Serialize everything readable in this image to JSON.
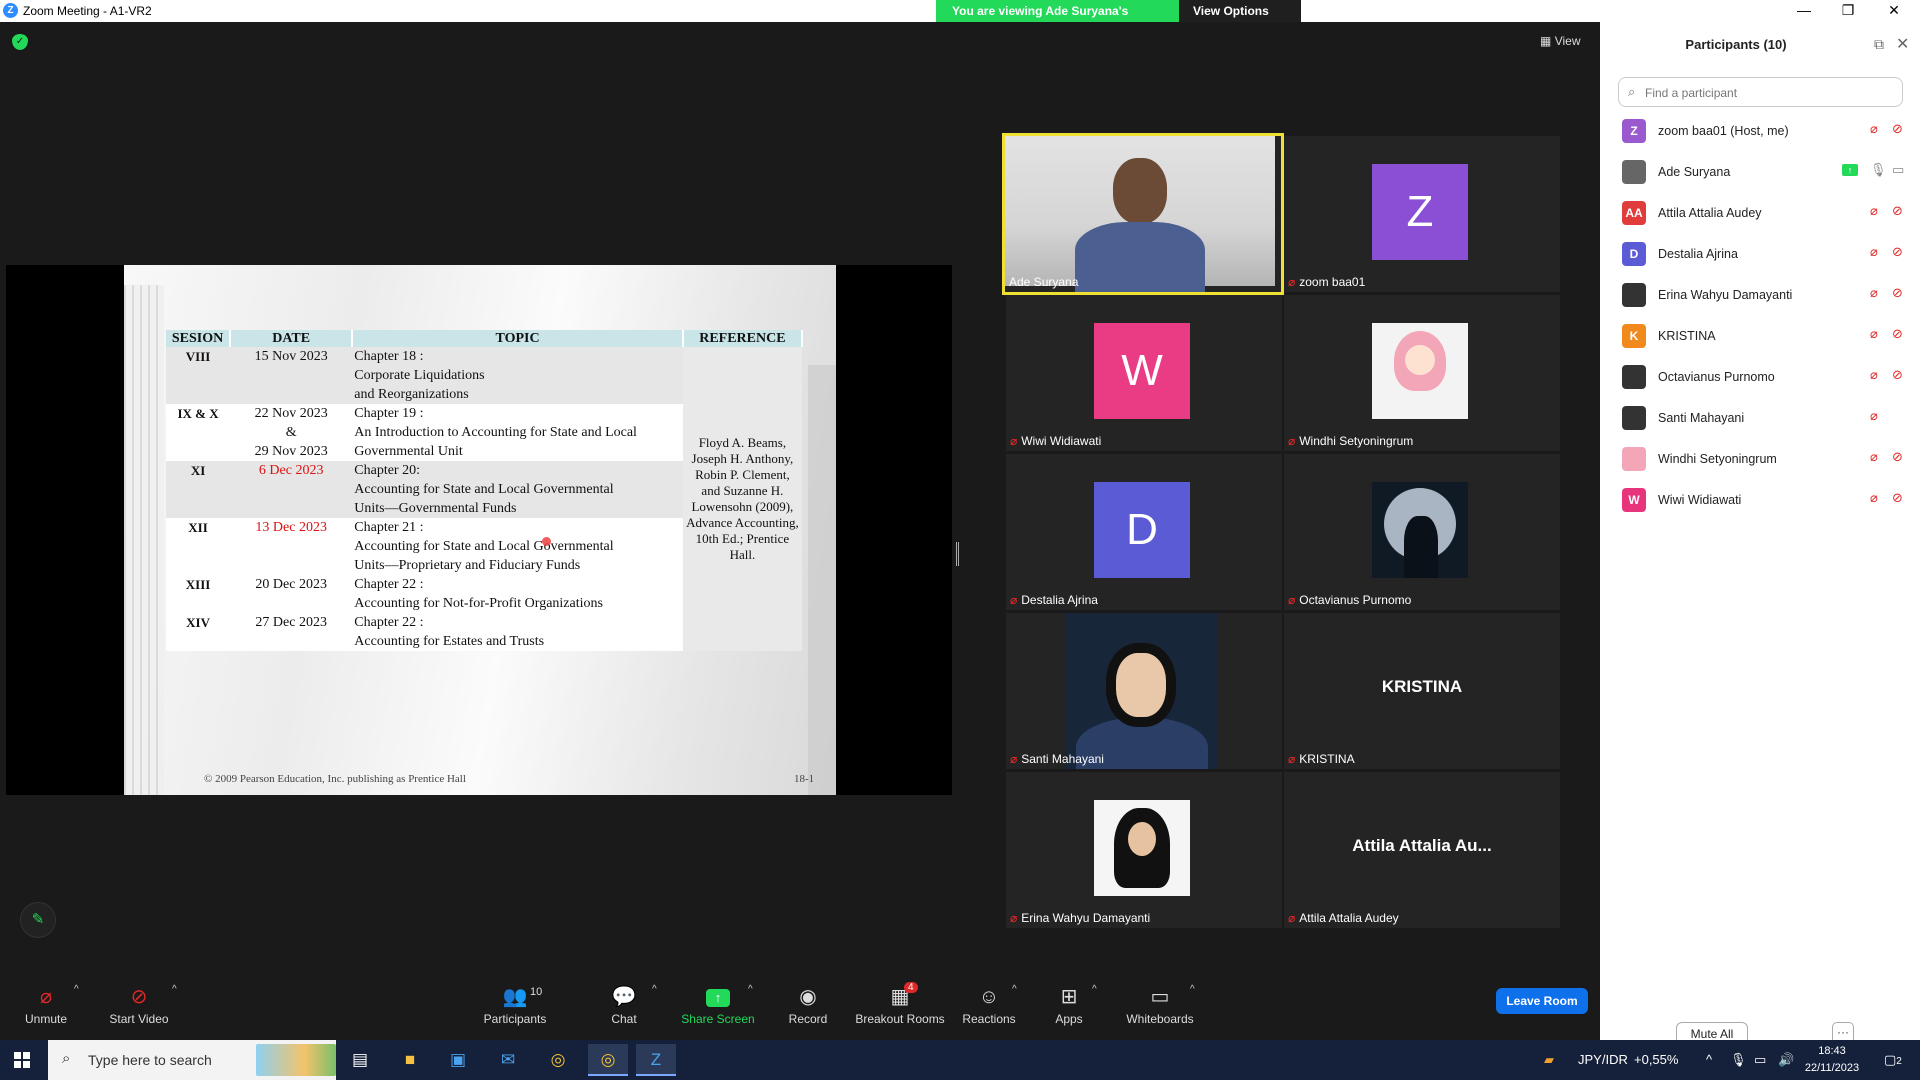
{
  "window": {
    "title": "Zoom Meeting - A1-VR2",
    "banner_viewing": "You are viewing Ade Suryana's screen",
    "banner_view_options": "View Options",
    "view_label": "View"
  },
  "slide": {
    "headers": [
      "SESION",
      "DATE",
      "TOPIC",
      "REFERENCE"
    ],
    "rows": [
      {
        "session": "VIII",
        "date": "15 Nov 2023",
        "topic": "Chapter 18 :\nCorporate Liquidations\nand Reorganizations"
      },
      {
        "session": "IX  & X",
        "date": "22 Nov 2023\n&\n29 Nov 2023",
        "topic": "Chapter 19 :\nAn Introduction to Accounting for State and Local\nGovernmental Unit"
      },
      {
        "session": "XI",
        "date": "6 Dec 2023",
        "topic": "Chapter 20:\nAccounting for State and Local Governmental\nUnits—Governmental Funds"
      },
      {
        "session": "XII",
        "date": "13 Dec 2023",
        "topic": "Chapter 21 :\nAccounting for State and Local Governmental\nUnits—Proprietary and Fiduciary Funds"
      },
      {
        "session": "XIII",
        "date": "20 Dec 2023",
        "topic": "Chapter 22 :\nAccounting for Not-for-Profit Organizations"
      },
      {
        "session": "XIV",
        "date": "27 Dec 2023",
        "topic": "Chapter 22 :\nAccounting for Estates and Trusts"
      }
    ],
    "reference": "Floyd A. Beams, Joseph H. Anthony, Robin P. Clement, and Suzanne H. Lowensohn (2009), Advance Accounting, 10th Ed.; Prentice Hall.",
    "footer": "© 2009 Pearson Education, Inc. publishing as Prentice Hall",
    "page": "18-1",
    "highlight_color": "#dd1111"
  },
  "gallery": {
    "tiles": [
      {
        "name": "Ade Suryana",
        "initial": ""
      },
      {
        "name": "zoom baa01",
        "initial": "Z"
      },
      {
        "name": "Wiwi Widiawati",
        "initial": "W"
      },
      {
        "name": "Windhi Setyoningrum",
        "initial": ""
      },
      {
        "name": "Destalia Ajrina",
        "initial": "D"
      },
      {
        "name": "Octavianus Purnomo",
        "initial": ""
      },
      {
        "name": "Santi Mahayani",
        "initial": ""
      },
      {
        "name": "KRISTINA",
        "initial": "KRISTINA"
      },
      {
        "name": "Erina Wahyu Damayanti",
        "initial": ""
      },
      {
        "name": "Attila Attalia Audey",
        "initial": "Attila Attalia Au..."
      }
    ]
  },
  "participants": {
    "title": "Participants (10)",
    "search_placeholder": "Find a participant",
    "list": [
      {
        "name": "zoom baa01 (Host, me)",
        "initial": "Z",
        "color": "#9b59d0"
      },
      {
        "name": "Ade Suryana",
        "initial": "",
        "color": "#666666"
      },
      {
        "name": "Attila Attalia Audey",
        "initial": "AA",
        "color": "#e03c3c"
      },
      {
        "name": "Destalia Ajrina",
        "initial": "D",
        "color": "#5b5bd6"
      },
      {
        "name": "Erina Wahyu Damayanti",
        "initial": "",
        "color": "#333333"
      },
      {
        "name": "KRISTINA",
        "initial": "K",
        "color": "#f08a1c"
      },
      {
        "name": "Octavianus Purnomo",
        "initial": "",
        "color": "#333333"
      },
      {
        "name": "Santi Mahayani",
        "initial": "",
        "color": "#333333"
      },
      {
        "name": "Windhi Setyoningrum",
        "initial": "",
        "color": "#f2a6b8"
      },
      {
        "name": "Wiwi Widiawati",
        "initial": "W",
        "color": "#e8347a"
      }
    ],
    "mute_all": "Mute All",
    "more": "···"
  },
  "toolbar": {
    "unmute": "Unmute",
    "start_video": "Start Video",
    "participants": "Participants",
    "participants_count": "10",
    "chat": "Chat",
    "share_screen": "Share Screen",
    "record": "Record",
    "breakout_rooms": "Breakout Rooms",
    "breakout_badge": "4",
    "reactions": "Reactions",
    "apps": "Apps",
    "whiteboards": "Whiteboards",
    "leave": "Leave Room"
  },
  "taskbar": {
    "search_placeholder": "Type here to search",
    "ticker": "JPY/IDR",
    "ticker_change": "+0,55%",
    "time": "18:43",
    "date": "22/11/2023",
    "notif_count": "2"
  },
  "colors": {
    "zoom_blue": "#0e71eb",
    "zoom_green": "#23d959",
    "active_speaker": "#f0e033",
    "muted_red": "#e02828"
  }
}
